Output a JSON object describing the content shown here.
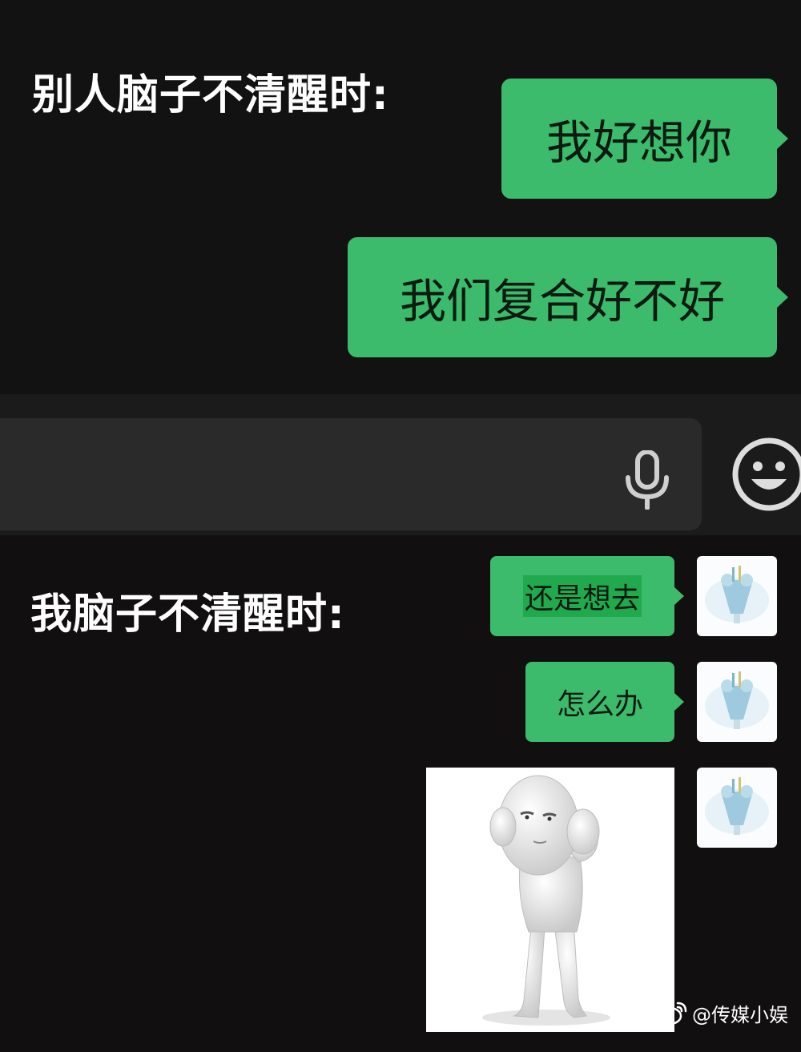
{
  "top": {
    "caption": "别人脑子不清醒时:",
    "messages": [
      "我好想你",
      "我们复合好不好"
    ]
  },
  "input_bar": {
    "icons": [
      "microphone-icon",
      "emoji-icon"
    ]
  },
  "bottom": {
    "caption": "我脑子不清醒时:",
    "messages": [
      "还是想去",
      "怎么办"
    ],
    "sticker": "head-in-hands-figure-sticker",
    "avatar": "ice-cream-avatar"
  },
  "watermark": {
    "icon": "weibo-icon",
    "text": "@传媒小娱"
  },
  "colors": {
    "bubble": "#3dbb6c",
    "highlight": "#21a94e",
    "background": "#121212"
  }
}
